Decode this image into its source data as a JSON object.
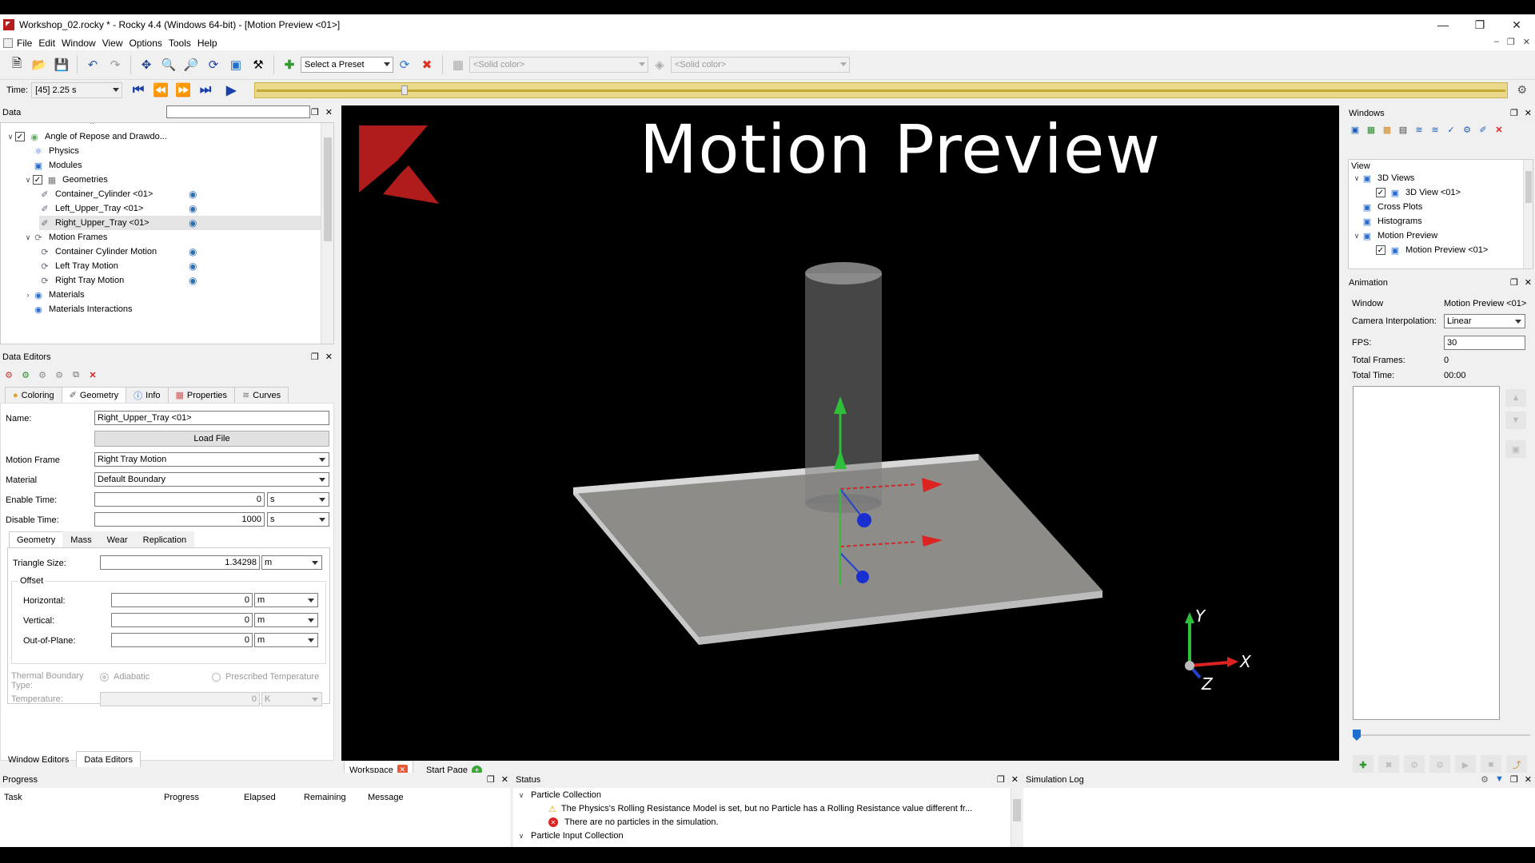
{
  "window": {
    "title": "Workshop_02.rocky * - Rocky 4.4 (Windows 64-bit) - [Motion Preview <01>]",
    "minimize_icon": "minimize-icon",
    "maximize_icon": "restore-icon",
    "close_icon": "close-icon"
  },
  "menu": [
    "File",
    "Edit",
    "Window",
    "View",
    "Options",
    "Tools",
    "Help"
  ],
  "toolbar": {
    "preset_label": "Select a Preset",
    "color1": "<Solid color>",
    "color2": "<Solid color>"
  },
  "timebar": {
    "time_label": "Time:",
    "time_value": "[45] 2.25 s",
    "progress_fraction": 0.115
  },
  "data_panel": {
    "title": "Data",
    "search_placeholder": "",
    "tree": [
      {
        "label": "Angle of Repose and Drawdo...",
        "level": 0,
        "expanded": true,
        "checkbox": true,
        "checked": true,
        "icon": "project-icon"
      },
      {
        "label": "Physics",
        "level": 1,
        "icon": "physics-icon"
      },
      {
        "label": "Modules",
        "level": 1,
        "icon": "modules-icon"
      },
      {
        "label": "Geometries",
        "level": 1,
        "expanded": true,
        "checkbox": true,
        "checked": true,
        "icon": "geometries-icon"
      },
      {
        "label": "Container_Cylinder <01>",
        "level": 2,
        "icon": "geometry-icon",
        "eye": true
      },
      {
        "label": "Left_Upper_Tray <01>",
        "level": 2,
        "icon": "geometry-icon",
        "eye": true
      },
      {
        "label": "Right_Upper_Tray <01>",
        "level": 2,
        "icon": "geometry-icon",
        "eye": true,
        "selected": true
      },
      {
        "label": "Motion Frames",
        "level": 1,
        "expanded": true,
        "icon": "motion-frames-icon"
      },
      {
        "label": "Container Cylinder Motion",
        "level": 2,
        "icon": "motion-icon",
        "eye": true
      },
      {
        "label": "Left Tray Motion",
        "level": 2,
        "icon": "motion-icon",
        "eye": true
      },
      {
        "label": "Right Tray Motion",
        "level": 2,
        "icon": "motion-icon",
        "eye": true
      },
      {
        "label": "Materials",
        "level": 1,
        "collapsed": true,
        "icon": "materials-icon"
      },
      {
        "label": "Materials Interactions",
        "level": 1,
        "icon": "materials-interactions-icon"
      }
    ]
  },
  "data_editors": {
    "title": "Data Editors",
    "tabs": [
      "Coloring",
      "Geometry",
      "Info",
      "Properties",
      "Curves"
    ],
    "active_tab": "Geometry",
    "name_label": "Name:",
    "name_value": "Right_Upper_Tray <01>",
    "load_file": "Load File",
    "motion_frame_label": "Motion Frame",
    "motion_frame_value": "Right Tray Motion",
    "material_label": "Material",
    "material_value": "Default Boundary",
    "enable_time_label": "Enable Time:",
    "enable_time_value": "0",
    "enable_time_unit": "s",
    "disable_time_label": "Disable Time:",
    "disable_time_value": "1000",
    "disable_time_unit": "s",
    "subtabs": [
      "Geometry",
      "Mass",
      "Wear",
      "Replication"
    ],
    "triangle_size_label": "Triangle Size:",
    "triangle_size_value": "1.34298",
    "triangle_size_unit": "m",
    "offset_label": "Offset",
    "horizontal_label": "Horizontal:",
    "horizontal_value": "0",
    "horizontal_unit": "m",
    "vertical_label": "Vertical:",
    "vertical_value": "0",
    "vertical_unit": "m",
    "oop_label": "Out-of-Plane:",
    "oop_value": "0",
    "oop_unit": "m",
    "thermal_label": "Thermal Boundary Type:",
    "adiabatic_label": "Adiabatic",
    "prescribed_label": "Prescribed Temperature",
    "temperature_label": "Temperature:",
    "temperature_value": "0",
    "temperature_unit": "K"
  },
  "left_bottom_tabs": [
    "Window Editors",
    "Data Editors"
  ],
  "viewport": {
    "title": "Motion Preview",
    "axis_y": "Y",
    "axis_x": "X",
    "axis_z": "Z"
  },
  "doc_tabs": [
    {
      "label": "Workspace",
      "icon": "close-tab-icon"
    },
    {
      "label": "Start Page",
      "icon": "add-tab-icon"
    }
  ],
  "windows_panel": {
    "title": "Windows",
    "view_label": "View",
    "tree": [
      {
        "label": "3D Views",
        "level": 0,
        "expanded": true
      },
      {
        "label": "3D View <01>",
        "level": 1,
        "checkbox": true,
        "checked": true
      },
      {
        "label": "Cross Plots",
        "level": 0
      },
      {
        "label": "Histograms",
        "level": 0
      },
      {
        "label": "Motion Preview",
        "level": 0,
        "expanded": true
      },
      {
        "label": "Motion Preview <01>",
        "level": 1,
        "checkbox": true,
        "checked": true
      }
    ]
  },
  "animation_panel": {
    "title": "Animation",
    "window_label": "Window",
    "window_value": "Motion Preview <01>",
    "camera_label": "Camera Interpolation:",
    "camera_value": "Linear",
    "fps_label": "FPS:",
    "fps_value": "30",
    "total_frames_label": "Total Frames:",
    "total_frames_value": "0",
    "total_time_label": "Total Time:",
    "total_time_value": "00:00"
  },
  "progress_panel": {
    "title": "Progress",
    "columns": [
      "Task",
      "Progress",
      "Elapsed",
      "Remaining",
      "Message"
    ]
  },
  "status_panel": {
    "title": "Status",
    "groups": [
      {
        "label": "Particle Collection",
        "items": [
          {
            "type": "warning",
            "text": "The Physics's Rolling Resistance Model is set, but no Particle has a Rolling Resistance value different fr..."
          },
          {
            "type": "error",
            "text": "There are no particles in the simulation."
          }
        ]
      },
      {
        "label": "Particle Input Collection",
        "items": []
      }
    ]
  },
  "simlog_panel": {
    "title": "Simulation Log"
  }
}
